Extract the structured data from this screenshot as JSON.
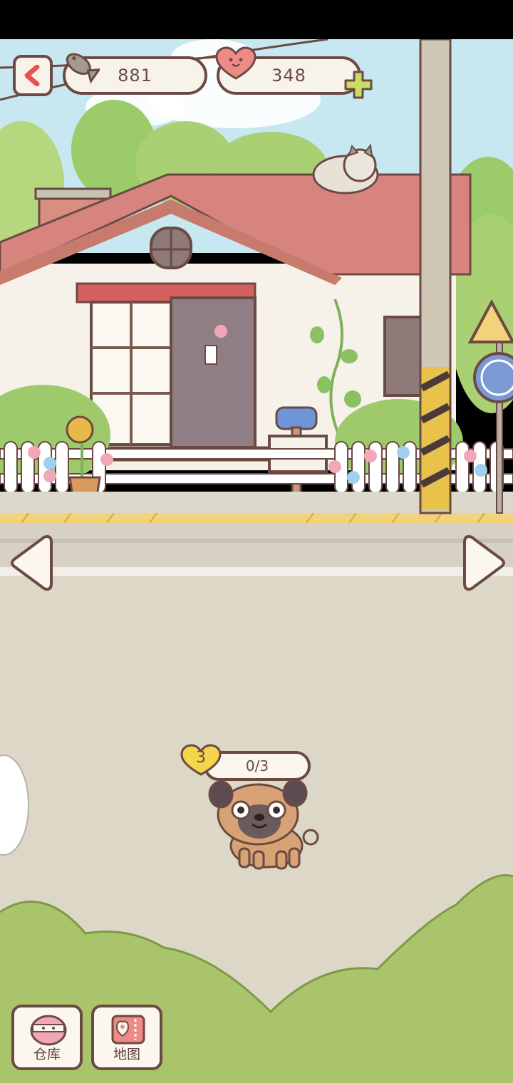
{
  "hud": {
    "fish_count": "881",
    "heart_count": "348"
  },
  "pet": {
    "level": "3",
    "progress": "0/3"
  },
  "bottom_buttons": {
    "storage_label": "仓库",
    "map_label": "地图"
  },
  "colors": {
    "outline": "#6b4a43",
    "sky": "#c9e8f2",
    "roof": "#d7847e",
    "road": "#ddd7c8",
    "grass": "#a9c46a",
    "accent_red": "#e5524f",
    "plus_green": "#c8dd63",
    "level_yellow": "#f5d54a"
  }
}
